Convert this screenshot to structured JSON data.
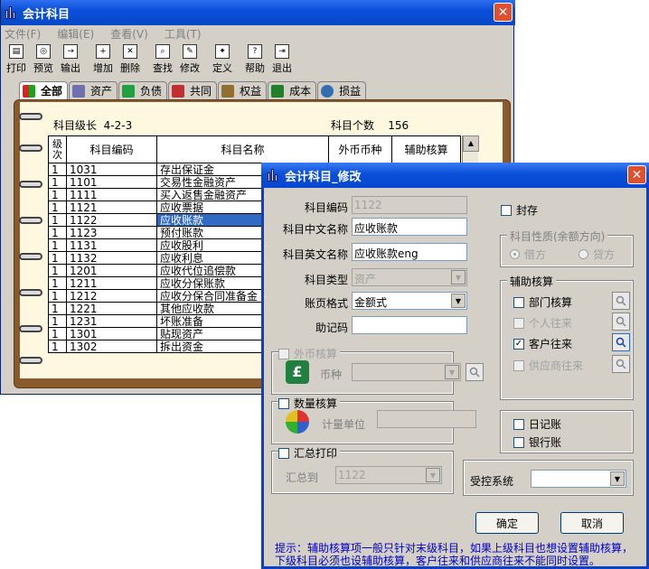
{
  "main_window": {
    "title": "会计科目",
    "menu": [
      "文件(F)",
      "编辑(E)",
      "查看(V)",
      "工具(T)"
    ],
    "toolbar": [
      "打印",
      "预览",
      "输出",
      "增加",
      "删除",
      "查找",
      "修改",
      "定义",
      "帮助",
      "退出"
    ],
    "tabs": [
      {
        "label": "全部",
        "color": "#cc2020"
      },
      {
        "label": "资产",
        "color": "#5050a0"
      },
      {
        "label": "负债",
        "color": "#208020"
      },
      {
        "label": "共同",
        "color": "#b03030"
      },
      {
        "label": "权益",
        "color": "#806020"
      },
      {
        "label": "成本",
        "color": "#207020"
      },
      {
        "label": "损益",
        "color": "#2060a0"
      }
    ],
    "level_label": "科目级长",
    "level_value": "4-2-3",
    "count_label": "科目个数",
    "count_value": "156",
    "table": {
      "headers": [
        "级次",
        "科目编码",
        "科目名称",
        "外币币种",
        "辅助核算"
      ],
      "rows": [
        {
          "level": "1",
          "code": "1031",
          "name": "存出保证金"
        },
        {
          "level": "1",
          "code": "1101",
          "name": "交易性金融资产"
        },
        {
          "level": "1",
          "code": "1111",
          "name": "买入返售金融资产"
        },
        {
          "level": "1",
          "code": "1121",
          "name": "应收票据"
        },
        {
          "level": "1",
          "code": "1122",
          "name": "应收账款"
        },
        {
          "level": "1",
          "code": "1123",
          "name": "预付账款"
        },
        {
          "level": "1",
          "code": "1131",
          "name": "应收股利"
        },
        {
          "level": "1",
          "code": "1132",
          "name": "应收利息"
        },
        {
          "level": "1",
          "code": "1201",
          "name": "应收代位追偿款"
        },
        {
          "level": "1",
          "code": "1211",
          "name": "应收分保账款"
        },
        {
          "level": "1",
          "code": "1212",
          "name": "应收分保合同准备金"
        },
        {
          "level": "1",
          "code": "1221",
          "name": "其他应收款"
        },
        {
          "level": "1",
          "code": "1231",
          "name": "坏账准备"
        },
        {
          "level": "1",
          "code": "1301",
          "name": "贴现资产"
        },
        {
          "level": "1",
          "code": "1302",
          "name": "拆出资金"
        }
      ]
    }
  },
  "dialog": {
    "title": "会计科目_修改",
    "code_label": "科目编码",
    "code_value": "1122",
    "cn_name_label": "科目中文名称",
    "cn_name_value": "应收账款",
    "en_name_label": "科目英文名称",
    "en_name_value": "应收账款eng",
    "type_label": "科目类型",
    "type_value": "资产",
    "format_label": "账页格式",
    "format_value": "金额式",
    "mnemonic_label": "助记码",
    "mnemonic_value": "",
    "sealed_label": "封存",
    "nature_group": "科目性质(余额方向)",
    "debit_label": "借方",
    "credit_label": "贷方",
    "aux_group": "辅助核算",
    "aux_items": [
      {
        "label": "部门核算",
        "checked": false,
        "disabled": false
      },
      {
        "label": "个人往来",
        "checked": false,
        "disabled": true
      },
      {
        "label": "客户往来",
        "checked": true,
        "disabled": false
      },
      {
        "label": "供应商往来",
        "checked": false,
        "disabled": true
      }
    ],
    "foreign_label": "外币核算",
    "currency_label": "币种",
    "currency_value": "",
    "qty_label": "数量核算",
    "unit_label": "计量单位",
    "unit_value": "",
    "summary_label": "汇总打印",
    "summary_to_label": "汇总到",
    "summary_to_value": "1122",
    "journal_label": "日记账",
    "bank_label": "银行账",
    "control_label": "受控系统",
    "control_value": "",
    "ok_label": "确定",
    "cancel_label": "取消",
    "hint": "提示：辅助核算项一般只针对末级科目，如果上级科目也想设置辅助核算，下级科目必须也设辅助核算，客户往来和供应商往来不能同时设置。"
  }
}
